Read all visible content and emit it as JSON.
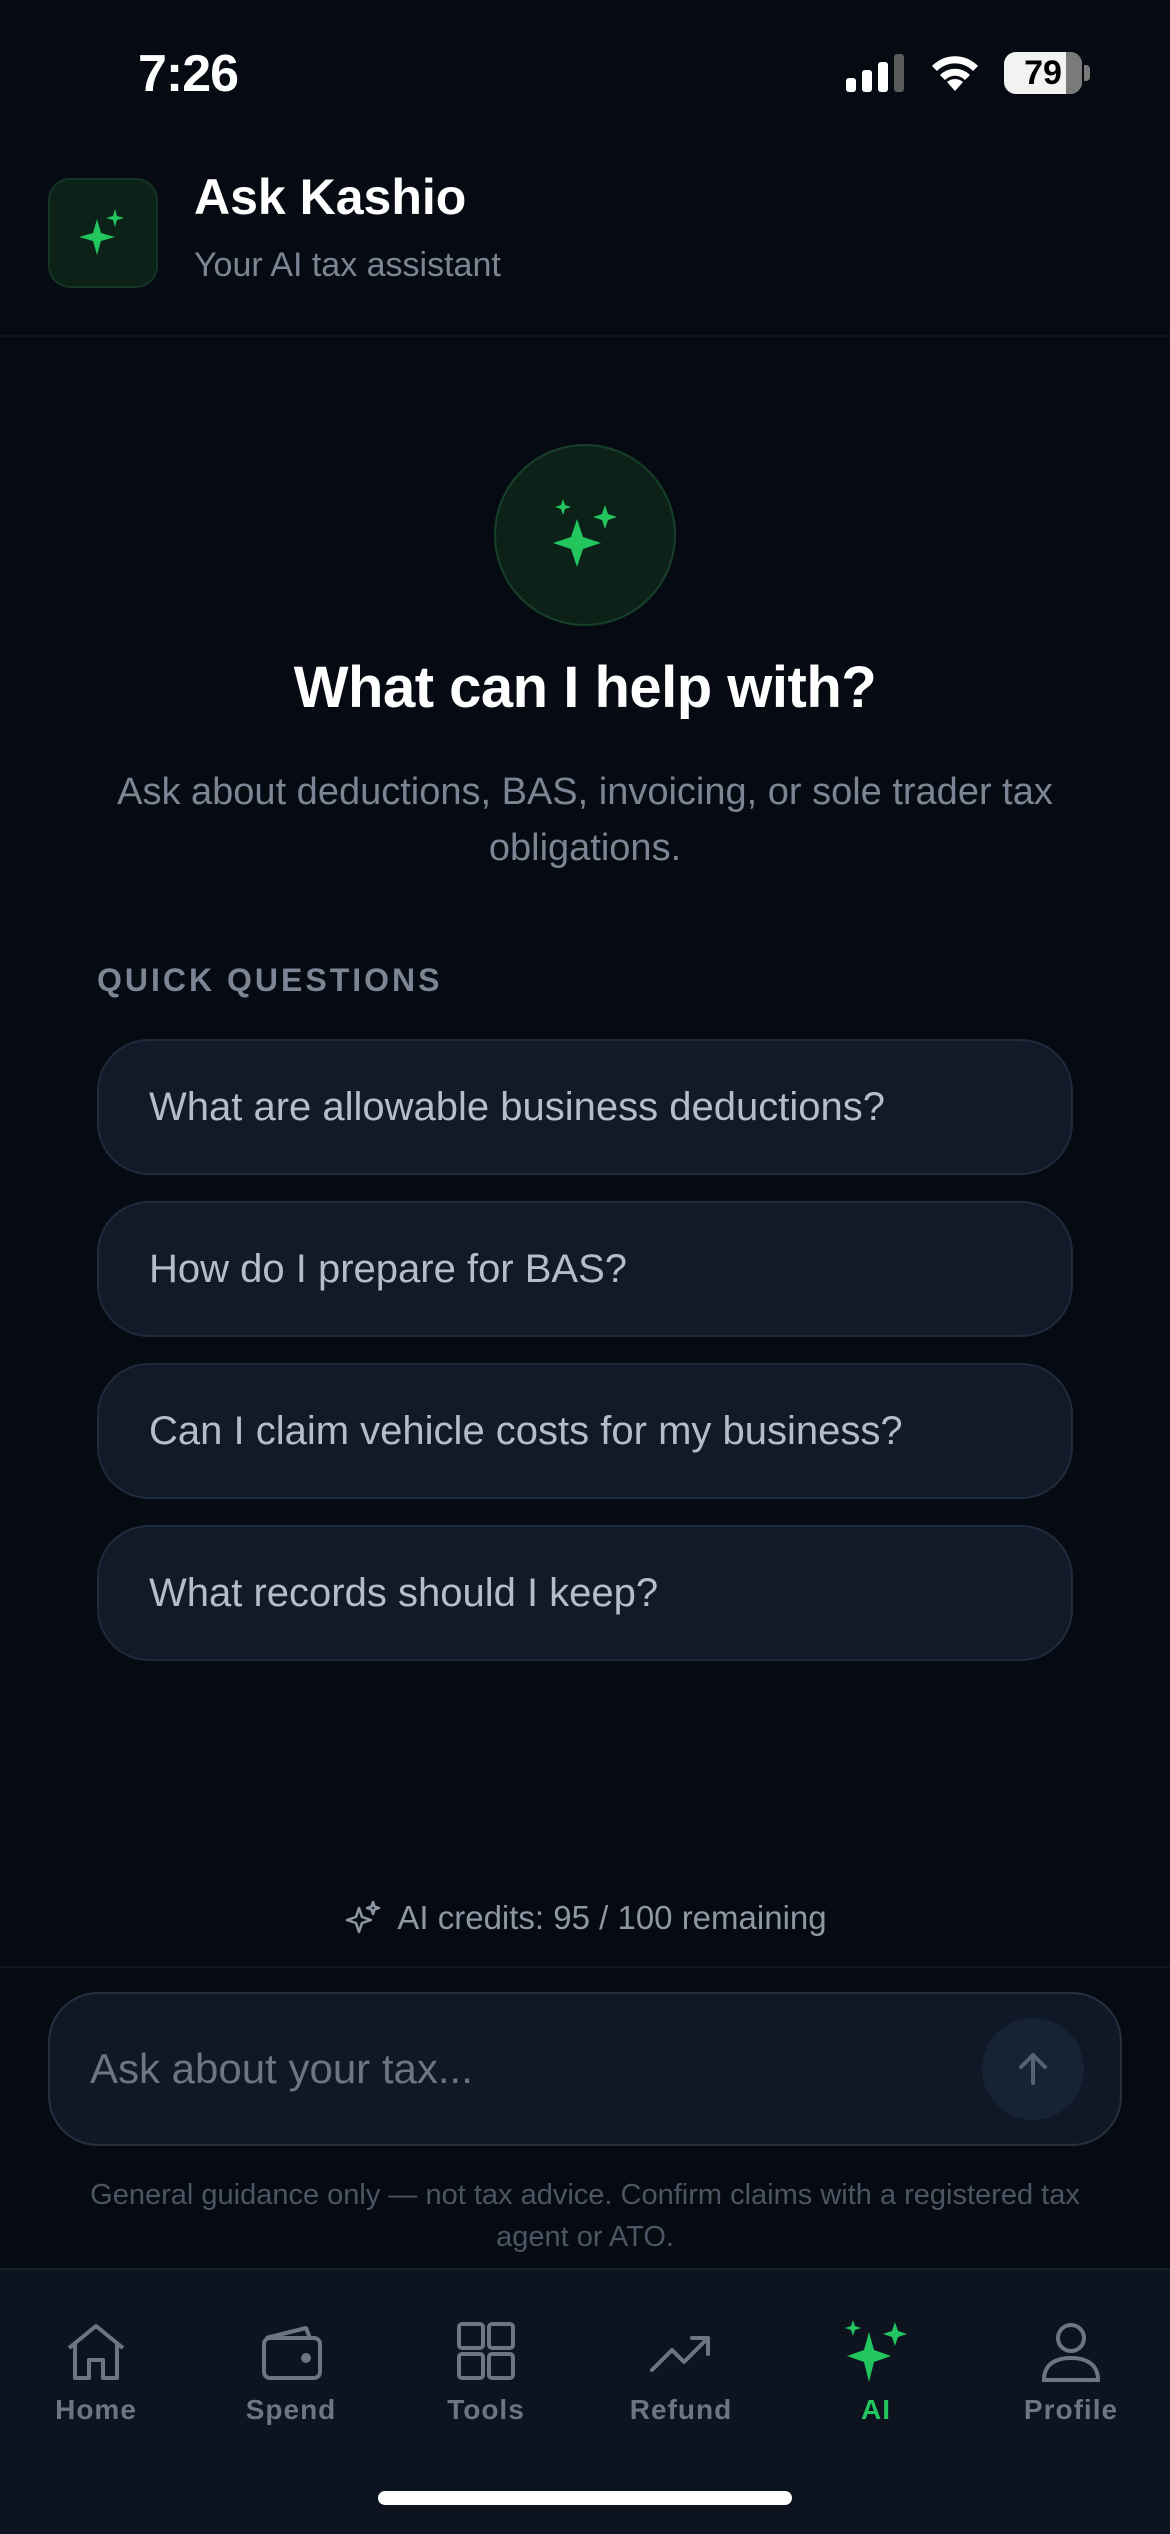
{
  "status_bar": {
    "time": "7:26",
    "battery": "79"
  },
  "header": {
    "title": "Ask Kashio",
    "subtitle": "Your AI tax assistant"
  },
  "hero": {
    "title": "What can I help with?",
    "description": "Ask about deductions, BAS, invoicing, or sole trader tax obligations."
  },
  "quick_questions": {
    "label": "QUICK QUESTIONS",
    "items": [
      "What are allowable business deductions?",
      "How do I prepare for BAS?",
      "Can I claim vehicle costs for my business?",
      "What records should I keep?"
    ]
  },
  "credits": {
    "text": "AI credits: 95 / 100 remaining"
  },
  "chat_input": {
    "placeholder": "Ask about your tax..."
  },
  "disclaimer": "General guidance only — not tax advice. Confirm claims with a registered tax agent or ATO.",
  "tabs": [
    {
      "label": "Home",
      "icon": "home-icon"
    },
    {
      "label": "Spend",
      "icon": "wallet-icon"
    },
    {
      "label": "Tools",
      "icon": "grid-icon"
    },
    {
      "label": "Refund",
      "icon": "trending-up-icon"
    },
    {
      "label": "AI",
      "icon": "sparkles-icon",
      "active": true
    },
    {
      "label": "Profile",
      "icon": "user-icon"
    }
  ],
  "colors": {
    "accent": "#22c55e",
    "background": "#060b13",
    "card": "#111a29"
  }
}
